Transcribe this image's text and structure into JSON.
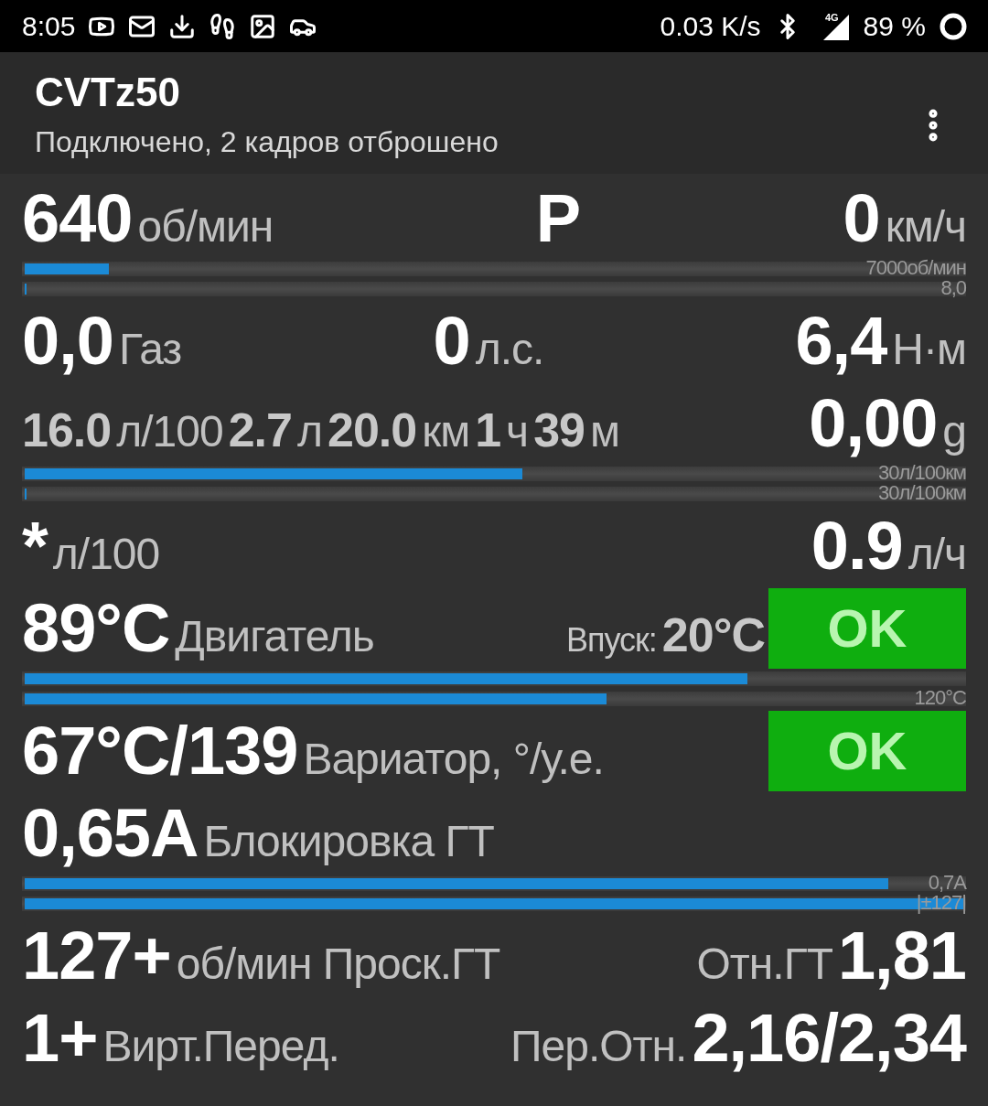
{
  "status_bar": {
    "time": "8:05",
    "speed": "0.03 K/s",
    "network": "4G",
    "battery": "89 %"
  },
  "app_bar": {
    "title": "CVTz50",
    "subtitle": "Подключено, 2 кадров отброшено"
  },
  "rows": [
    {
      "kind": "readings",
      "groups": [
        {
          "parts": [
            {
              "kind": "value",
              "text": "640"
            },
            {
              "kind": "unit",
              "text": "об/мин"
            }
          ]
        },
        {
          "parts": [
            {
              "kind": "value",
              "text": "P"
            }
          ]
        },
        {
          "parts": [
            {
              "kind": "value",
              "text": "0"
            },
            {
              "kind": "unit",
              "text": "км/ч"
            }
          ]
        }
      ]
    },
    {
      "kind": "bars",
      "bars": [
        {
          "level": 0.09,
          "max_label": "7000об/мин"
        },
        {
          "level": 0,
          "max_label": "8,0"
        }
      ]
    },
    {
      "kind": "readings",
      "groups": [
        {
          "parts": [
            {
              "kind": "value",
              "text": "0,0"
            },
            {
              "kind": "unit",
              "text": "Газ"
            }
          ]
        },
        {
          "parts": [
            {
              "kind": "value",
              "text": "0"
            },
            {
              "kind": "unit",
              "text": "л.с."
            }
          ]
        },
        {
          "parts": [
            {
              "kind": "value",
              "text": "6,4"
            },
            {
              "kind": "unit",
              "text": "Н·м"
            }
          ]
        }
      ]
    },
    {
      "kind": "readings",
      "groups": [
        {
          "parts": [
            {
              "kind": "dim_value",
              "text": "16.0"
            },
            {
              "kind": "unit",
              "text": "л/100"
            },
            {
              "kind": "dim_value",
              "text": "2.7"
            },
            {
              "kind": "unit",
              "text": "л"
            },
            {
              "kind": "dim_value",
              "text": "20.0"
            },
            {
              "kind": "unit",
              "text": "км"
            },
            {
              "kind": "dim_value",
              "text": "1"
            },
            {
              "kind": "unit",
              "text": "ч"
            },
            {
              "kind": "dim_value",
              "text": "39"
            },
            {
              "kind": "unit",
              "text": "м"
            }
          ]
        },
        {
          "parts": [
            {
              "kind": "value",
              "text": "0,00"
            },
            {
              "kind": "unit",
              "text": "g"
            }
          ]
        }
      ]
    },
    {
      "kind": "bars",
      "bars": [
        {
          "level": 0.53,
          "max_label": "30л/100км"
        },
        {
          "level": 0,
          "max_label": "30л/100км"
        }
      ]
    },
    {
      "kind": "readings",
      "groups": [
        {
          "parts": [
            {
              "kind": "value",
              "text": "*"
            },
            {
              "kind": "unit",
              "text": "л/100"
            }
          ]
        },
        {
          "parts": [
            {
              "kind": "value",
              "text": "0.9"
            },
            {
              "kind": "unit",
              "text": "л/ч"
            }
          ]
        }
      ]
    },
    {
      "kind": "readings",
      "badge": "OK",
      "groups": [
        {
          "parts": [
            {
              "kind": "value",
              "text": "89°C"
            },
            {
              "kind": "unit",
              "text": "Двигатель"
            }
          ]
        },
        {
          "parts": [
            {
              "kind": "label",
              "text": "Впуск:"
            },
            {
              "kind": "dim_value",
              "text": "20°C"
            }
          ]
        }
      ]
    },
    {
      "kind": "bars",
      "bars": [
        {
          "level": 0.77
        },
        {
          "level": 0.62,
          "max_label": "120°C"
        }
      ]
    },
    {
      "kind": "readings",
      "badge": "OK",
      "groups": [
        {
          "parts": [
            {
              "kind": "value",
              "text": "67°C/139"
            },
            {
              "kind": "unit",
              "text": "Вариатор, °/у.е."
            }
          ]
        }
      ]
    },
    {
      "kind": "readings",
      "groups": [
        {
          "parts": [
            {
              "kind": "value",
              "text": "0,65A"
            },
            {
              "kind": "unit",
              "text": "Блокировка ГТ"
            }
          ]
        }
      ]
    },
    {
      "kind": "bars",
      "bars": [
        {
          "level": 0.92,
          "max_label": "0,7A"
        },
        {
          "level": 1,
          "max_label": "|±127|"
        }
      ]
    },
    {
      "kind": "readings",
      "groups": [
        {
          "parts": [
            {
              "kind": "value",
              "text": "127+"
            },
            {
              "kind": "unit",
              "text": "об/мин Проск.ГТ"
            }
          ]
        },
        {
          "parts": [
            {
              "kind": "unit",
              "text": "Отн.ГТ"
            },
            {
              "kind": "value",
              "text": "1,81"
            }
          ]
        }
      ]
    },
    {
      "kind": "readings",
      "groups": [
        {
          "parts": [
            {
              "kind": "value",
              "text": "1+"
            },
            {
              "kind": "unit",
              "text": "Вирт.Перед."
            }
          ]
        },
        {
          "parts": [
            {
              "kind": "unit",
              "text": "Пер.Отн."
            },
            {
              "kind": "value",
              "text": "2,16/2,34"
            }
          ]
        }
      ]
    }
  ]
}
